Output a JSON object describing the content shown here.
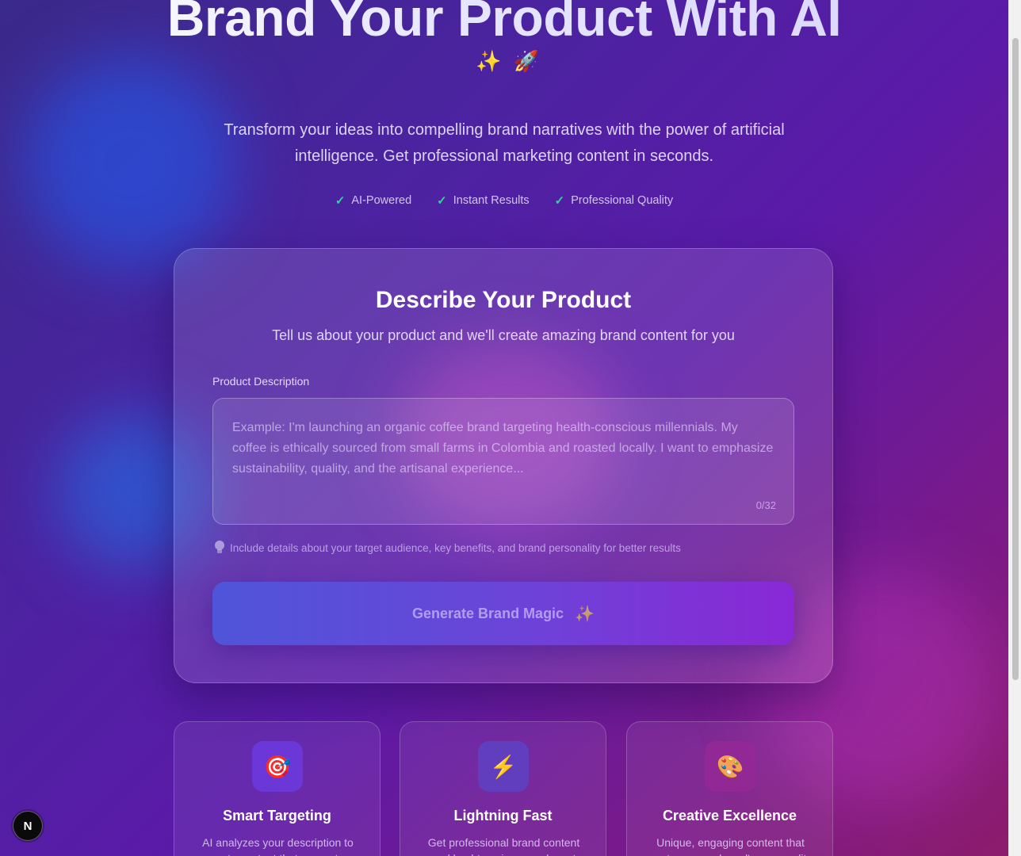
{
  "hero": {
    "title": "Brand Your Product With AI",
    "emoji": "✨ 🚀",
    "subtitle": "Transform your ideas into compelling brand narratives with the power of artificial intelligence. Get professional marketing content in seconds.",
    "badges": [
      {
        "check": "✓",
        "label": "AI-Powered"
      },
      {
        "check": "✓",
        "label": "Instant Results"
      },
      {
        "check": "✓",
        "label": "Professional Quality"
      }
    ]
  },
  "form": {
    "title": "Describe Your Product",
    "subtitle": "Tell us about your product and we'll create amazing brand content for you",
    "field_label": "Product Description",
    "placeholder": "Example: I'm launching an organic coffee brand targeting health-conscious millennials. My coffee is ethically sourced from small farms in Colombia and roasted locally. I want to emphasize sustainability, quality, and the artisanal experience...",
    "counter": "0/32",
    "hint": "Include details about your target audience, key benefits, and brand personality for better results",
    "button_label": "Generate Brand Magic",
    "button_icon": "✨"
  },
  "features": [
    {
      "icon": "🎯",
      "title": "Smart Targeting",
      "desc": "AI analyzes your description to create content that resonates with"
    },
    {
      "icon": "⚡",
      "title": "Lightning Fast",
      "desc": "Get professional brand content and hashtags in seconds, not"
    },
    {
      "icon": "🎨",
      "title": "Creative Excellence",
      "desc": "Unique, engaging content that captures your brand's personality"
    }
  ],
  "dev_badge": "N"
}
